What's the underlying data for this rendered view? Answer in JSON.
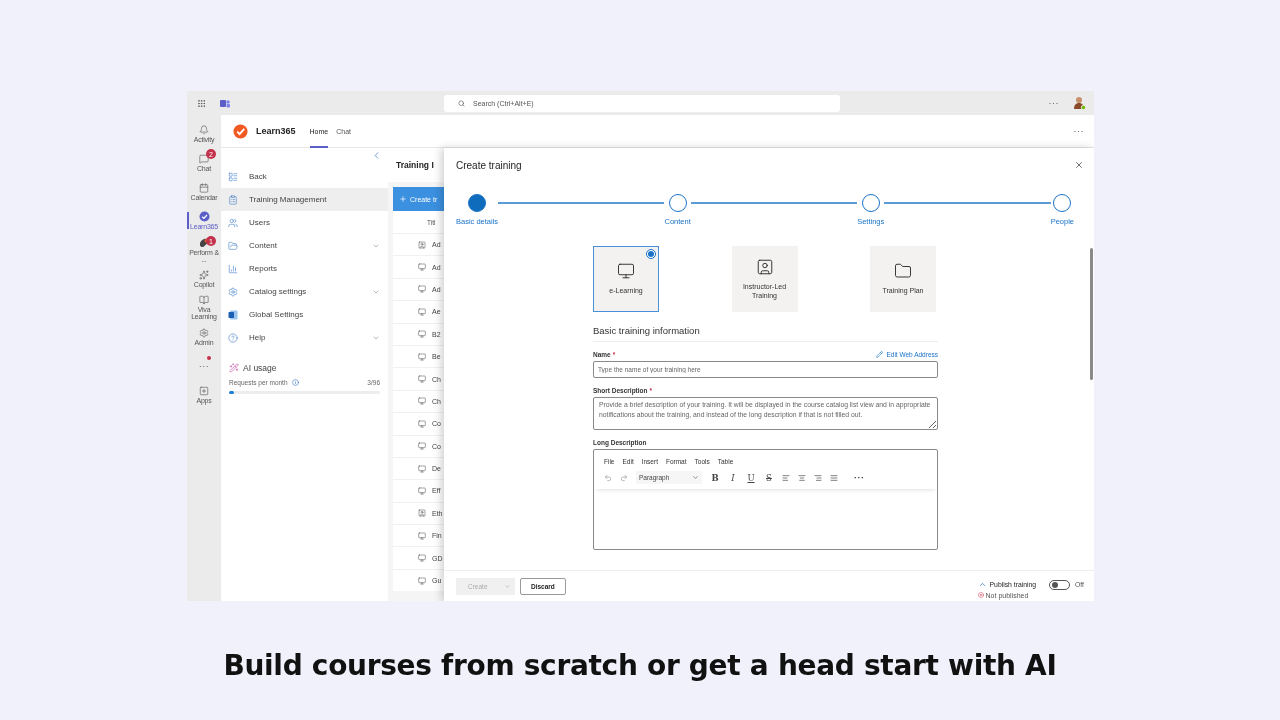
{
  "topbar": {
    "search_placeholder": "Search (Ctrl+Alt+E)",
    "more": "···"
  },
  "rail": [
    {
      "kind": "app",
      "label": "Activity",
      "selected": false
    },
    {
      "kind": "app",
      "label": "Chat",
      "selected": false,
      "badge": "2"
    },
    {
      "kind": "app",
      "label": "Calendar",
      "selected": false
    },
    {
      "kind": "app",
      "label": "Learn365",
      "selected": true
    },
    {
      "kind": "app",
      "label": "Perform & ...",
      "selected": false,
      "badge": "1"
    },
    {
      "kind": "app",
      "label": "Copilot",
      "selected": false
    },
    {
      "kind": "app",
      "label": "Viva Learning",
      "selected": false
    },
    {
      "kind": "app",
      "label": "Admin",
      "selected": false
    },
    {
      "kind": "more",
      "label": "···",
      "notified": true
    },
    {
      "kind": "app",
      "label": "Apps",
      "selected": false
    }
  ],
  "app": {
    "name": "Learn365",
    "tabs": [
      {
        "label": "Home",
        "selected": true
      },
      {
        "label": "Chat",
        "selected": false
      }
    ],
    "more": "···"
  },
  "sidebar": {
    "items": [
      {
        "label": "Back",
        "selected": false,
        "expandable": false
      },
      {
        "label": "Training Management",
        "selected": true,
        "expandable": false
      },
      {
        "label": "Users",
        "selected": false,
        "expandable": false
      },
      {
        "label": "Content",
        "selected": false,
        "expandable": true
      },
      {
        "label": "Reports",
        "selected": false,
        "expandable": false
      },
      {
        "label": "Catalog settings",
        "selected": false,
        "expandable": true
      },
      {
        "label": "Global Settings",
        "selected": false,
        "expandable": false
      },
      {
        "label": "Help",
        "selected": false,
        "expandable": true
      }
    ],
    "ai_usage": {
      "title": "AI usage",
      "label": "Requests per month",
      "count": "3/96",
      "level": 0.03
    }
  },
  "list": {
    "title": "Training I",
    "create_button": "Create tr",
    "column": "Titl",
    "rows": [
      {
        "kind": "classroom",
        "text": "Ad"
      },
      {
        "kind": "elearning",
        "text": "Ad"
      },
      {
        "kind": "elearning",
        "text": "Ad"
      },
      {
        "kind": "elearning",
        "text": "Ae"
      },
      {
        "kind": "elearning",
        "text": "B2"
      },
      {
        "kind": "elearning",
        "text": "Be"
      },
      {
        "kind": "elearning",
        "text": "Ch"
      },
      {
        "kind": "elearning",
        "text": "Ch"
      },
      {
        "kind": "elearning",
        "text": "Co"
      },
      {
        "kind": "elearning",
        "text": "Co"
      },
      {
        "kind": "elearning",
        "text": "De"
      },
      {
        "kind": "elearning",
        "text": "Eff"
      },
      {
        "kind": "classroom",
        "text": "Eth"
      },
      {
        "kind": "elearning",
        "text": "Fin"
      },
      {
        "kind": "elearning",
        "text": "GD"
      },
      {
        "kind": "elearning",
        "text": "Gu"
      }
    ]
  },
  "dialog": {
    "title": "Create training",
    "steps": [
      {
        "label": "Basic details",
        "selected": true
      },
      {
        "label": "Content",
        "selected": false
      },
      {
        "label": "Settings",
        "selected": false
      },
      {
        "label": "People",
        "selected": false
      }
    ],
    "types": [
      {
        "kind": "elearning",
        "label": "e-Learning",
        "selected": true
      },
      {
        "kind": "classroom",
        "label": "Instructor-Led Training",
        "selected": false
      },
      {
        "kind": "plan",
        "label": "Training Plan",
        "selected": false
      }
    ],
    "section": "Basic training information",
    "name": {
      "label": "Name",
      "required_mark": "*",
      "link": "Edit Web Address",
      "placeholder": "Type the name of your training here"
    },
    "short_description": {
      "label": "Short Description",
      "required_mark": "*",
      "placeholder": "Provide a brief description of your training. It will be displayed in the course catalog list view and in appropriate notifications about the training, and instead of the long description if that is not filled out."
    },
    "long_description": {
      "label": "Long Description",
      "menu": [
        "File",
        "Edit",
        "Insert",
        "Format",
        "Tools",
        "Table"
      ],
      "block_format": "Paragraph",
      "format_buttons": [
        {
          "kind": "bold",
          "label": "B"
        },
        {
          "kind": "italic",
          "label": "I"
        },
        {
          "kind": "underline",
          "label": "U"
        },
        {
          "kind": "strike",
          "label": "S"
        }
      ],
      "more": "···"
    },
    "footer": {
      "create": "Create",
      "create_disabled": true,
      "discard": "Discard",
      "publish_label": "Publish training",
      "publish_on": false,
      "toggle_text": "Off",
      "status": "Not published"
    }
  },
  "caption": "Build courses from scratch or get a head start with AI"
}
